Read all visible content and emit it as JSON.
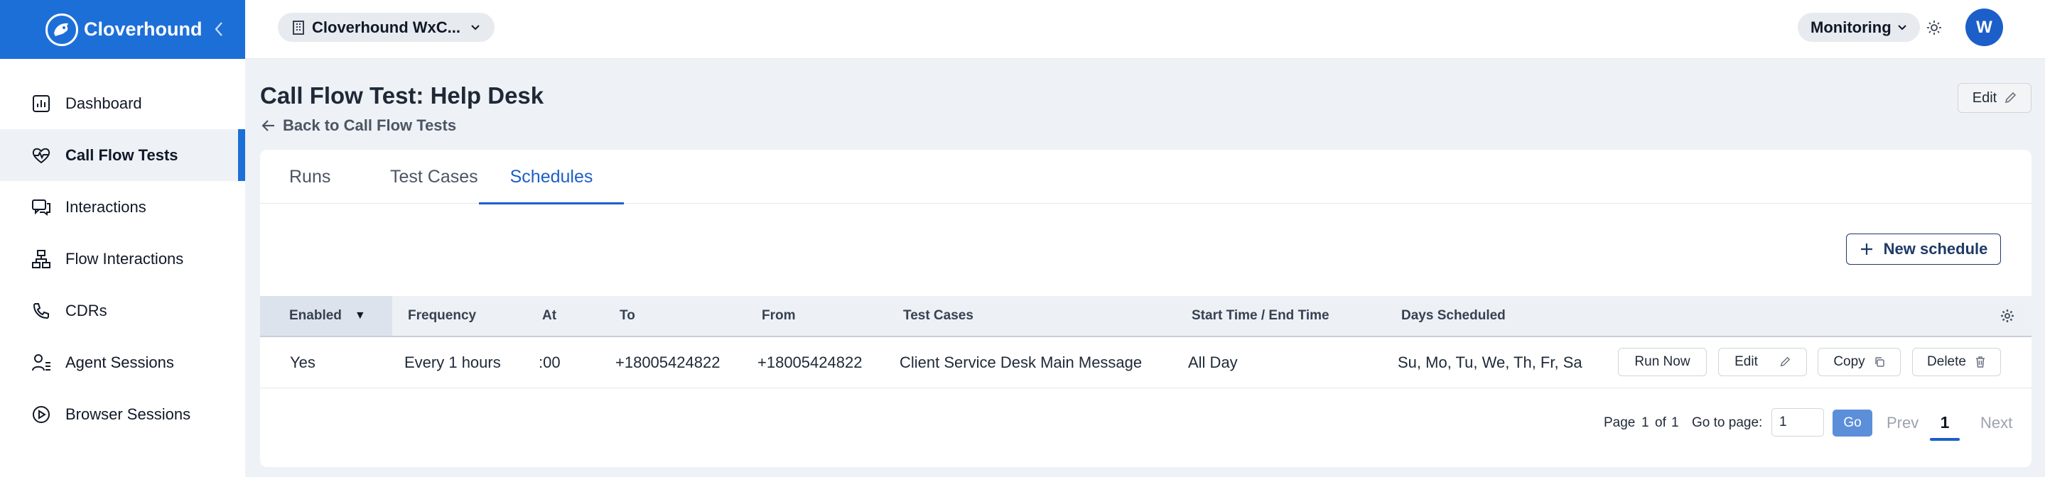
{
  "app": {
    "name": "Cloverhound",
    "brand_color": "#1d6fd8"
  },
  "sidebar": {
    "items": [
      {
        "label": "Dashboard",
        "icon": "bar-chart-icon"
      },
      {
        "label": "Call Flow Tests",
        "icon": "heart-pulse-icon",
        "active": true
      },
      {
        "label": "Interactions",
        "icon": "chat-bubbles-icon"
      },
      {
        "label": "Flow Interactions",
        "icon": "flow-diagram-icon"
      },
      {
        "label": "CDRs",
        "icon": "phone-icon"
      },
      {
        "label": "Agent Sessions",
        "icon": "user-list-icon"
      },
      {
        "label": "Browser Sessions",
        "icon": "play-circle-icon"
      }
    ]
  },
  "topbar": {
    "org": "Cloverhound WxC...",
    "mode": "Monitoring",
    "avatar_initial": "W"
  },
  "page": {
    "title": "Call Flow Test: Help Desk",
    "back_label": "Back to Call Flow Tests",
    "edit_label": "Edit"
  },
  "tabs": [
    {
      "label": "Runs"
    },
    {
      "label": "Test Cases"
    },
    {
      "label": "Schedules",
      "active": true
    }
  ],
  "schedules": {
    "new_label": "New schedule",
    "columns": [
      "Enabled",
      "Frequency",
      "At",
      "To",
      "From",
      "Test Cases",
      "Start Time / End Time",
      "Days Scheduled"
    ],
    "sort_indicator": "▼",
    "rows": [
      {
        "enabled": "Yes",
        "frequency": "Every 1 hours",
        "at": ":00",
        "to": "+18005424822",
        "from": "+18005424822",
        "test_cases": "Client Service Desk Main Message",
        "time": "All Day",
        "days": "Su, Mo, Tu, We, Th, Fr, Sa",
        "actions": {
          "run": "Run Now",
          "edit": "Edit",
          "copy": "Copy",
          "delete": "Delete"
        }
      }
    ]
  },
  "pagination": {
    "page_label": "Page",
    "current": "1",
    "of_label": "of",
    "total": "1",
    "goto_label": "Go to page:",
    "goto_value": "1",
    "go_label": "Go",
    "prev_label": "Prev",
    "next_label": "Next",
    "page_number": "1"
  }
}
